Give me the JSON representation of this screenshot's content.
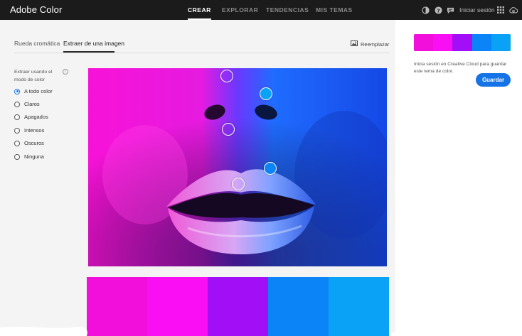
{
  "app": {
    "title": "Adobe Color"
  },
  "nav": {
    "items": [
      {
        "label": "CREAR",
        "active": true
      },
      {
        "label": "EXPLORAR",
        "active": false
      },
      {
        "label": "TENDENCIAS",
        "active": false
      },
      {
        "label": "MIS TEMAS",
        "active": false
      }
    ],
    "signin_label": "Iniciar sesión",
    "icons": [
      "contrast-icon",
      "help-icon",
      "chat-icon",
      "apps-grid-icon",
      "creative-cloud-icon"
    ]
  },
  "tabs": [
    {
      "label": "Rueda cromática",
      "active": false
    },
    {
      "label": "Extraer de una imagen",
      "active": true
    }
  ],
  "replace_label": "Reemplazar",
  "color_mode": {
    "title": "Extraer usando el modo de color",
    "options": [
      {
        "label": "A todo color",
        "selected": true
      },
      {
        "label": "Claros",
        "selected": false
      },
      {
        "label": "Apagados",
        "selected": false
      },
      {
        "label": "Intensos",
        "selected": false
      },
      {
        "label": "Oscuros",
        "selected": false
      },
      {
        "label": "Ninguna",
        "selected": false
      }
    ]
  },
  "theme_colors": [
    "#f20fdc",
    "#fa0ff5",
    "#a20ff6",
    "#0a84f7",
    "#0aa2f6"
  ],
  "save_panel": {
    "note": "Inicia sesión en Creative Cloud para guardar este tema de color.",
    "save_label": "Guardar"
  },
  "accent_color": "#1473e6"
}
